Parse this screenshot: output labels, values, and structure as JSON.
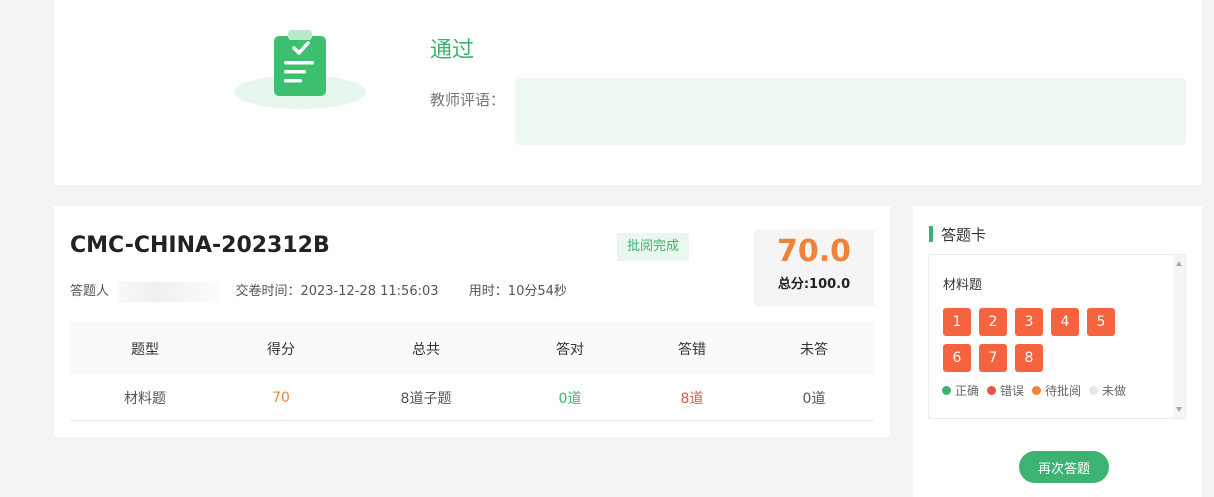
{
  "result": {
    "status_text": "通过",
    "comment_label": "教师评语：",
    "comment_value": ""
  },
  "exam": {
    "title": "CMC-CHINA-202312B",
    "status_badge": "批阅完成",
    "score": "70.0",
    "total_score": "总分:100.0",
    "taker_label": "答题人",
    "submit_time": "交卷时间：2023-12-28 11:56:03",
    "duration": "用时：10分54秒"
  },
  "table": {
    "headers": [
      "题型",
      "得分",
      "总共",
      "答对",
      "答错",
      "未答"
    ],
    "rows": [
      [
        "材料题",
        "70",
        "8道子题",
        "0道",
        "8道",
        "0道"
      ]
    ]
  },
  "answer_sheet": {
    "title": "答题卡",
    "section": "材料题",
    "questions": [
      "1",
      "2",
      "3",
      "4",
      "5",
      "6",
      "7",
      "8"
    ],
    "legend": [
      {
        "label": "正确",
        "color": "#3cb371"
      },
      {
        "label": "错误",
        "color": "#e4593d"
      },
      {
        "label": "待批阅",
        "color": "#f0833a"
      },
      {
        "label": "未做",
        "color": "#e6e6e6"
      }
    ],
    "retry_label": "再次答题"
  },
  "colors": {
    "accent": "#3cb371",
    "score": "#f0833a",
    "wrong": "#f5633f"
  }
}
